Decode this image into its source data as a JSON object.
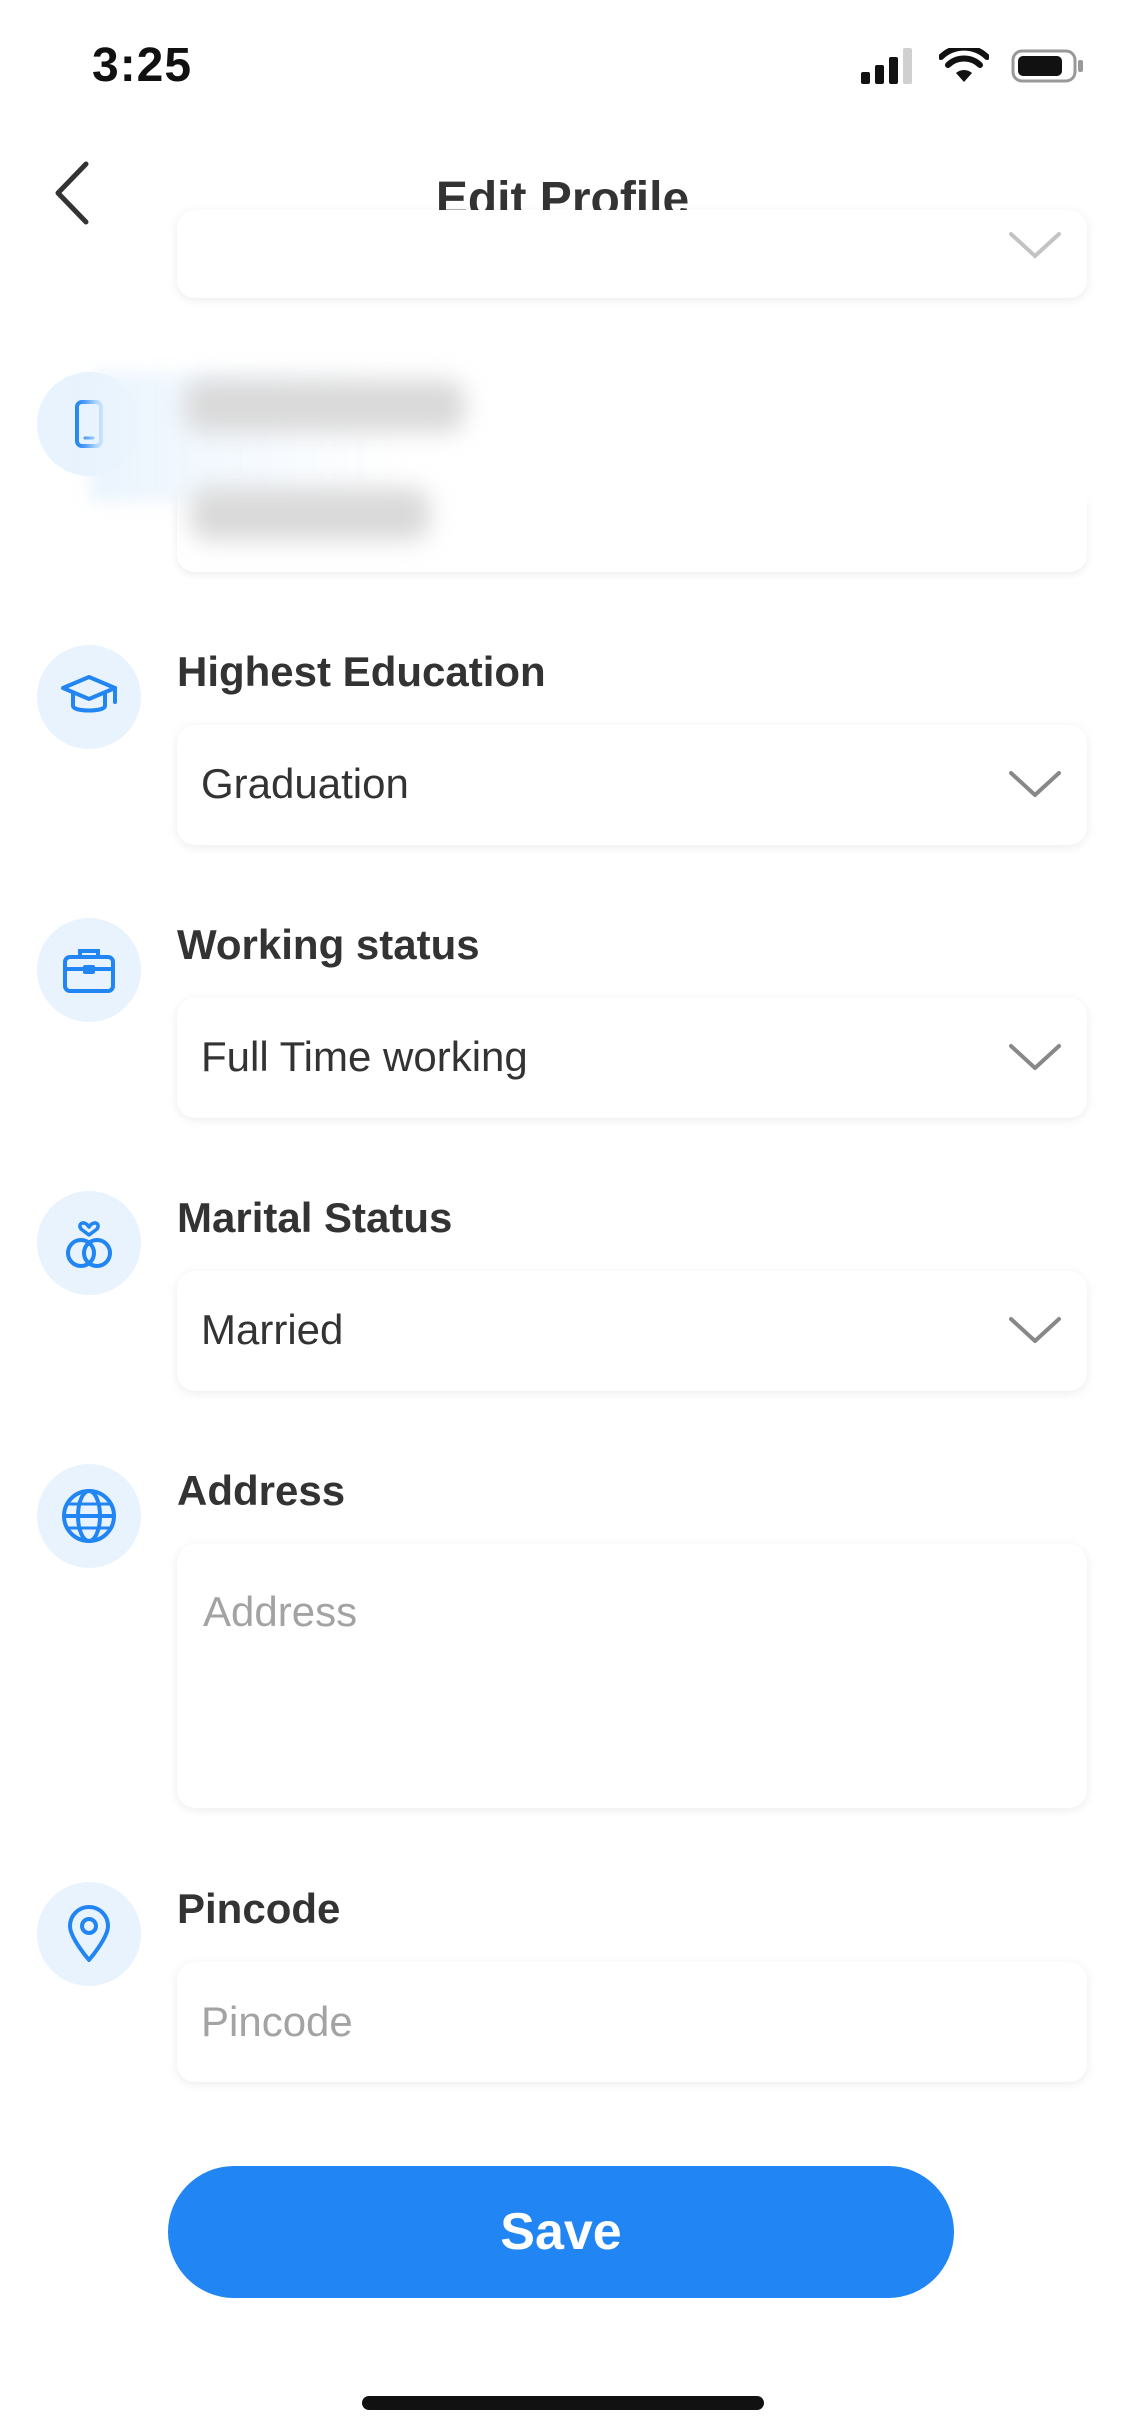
{
  "status_bar": {
    "time": "3:25"
  },
  "header": {
    "title": "Edit Profile"
  },
  "fields": {
    "education": {
      "label": "Highest Education",
      "value": "Graduation",
      "icon": "graduation-cap-icon"
    },
    "working": {
      "label": "Working status",
      "value": "Full Time working",
      "icon": "briefcase-icon"
    },
    "marital": {
      "label": "Marital Status",
      "value": "Married",
      "icon": "rings-icon"
    },
    "address": {
      "label": "Address",
      "placeholder": "Address",
      "icon": "globe-icon"
    },
    "pincode": {
      "label": "Pincode",
      "placeholder": "Pincode",
      "icon": "map-pin-icon"
    }
  },
  "actions": {
    "save_label": "Save"
  },
  "colors": {
    "accent": "#2185f3",
    "icon_bg": "#e8f3fd",
    "placeholder": "#a3a3a3"
  }
}
